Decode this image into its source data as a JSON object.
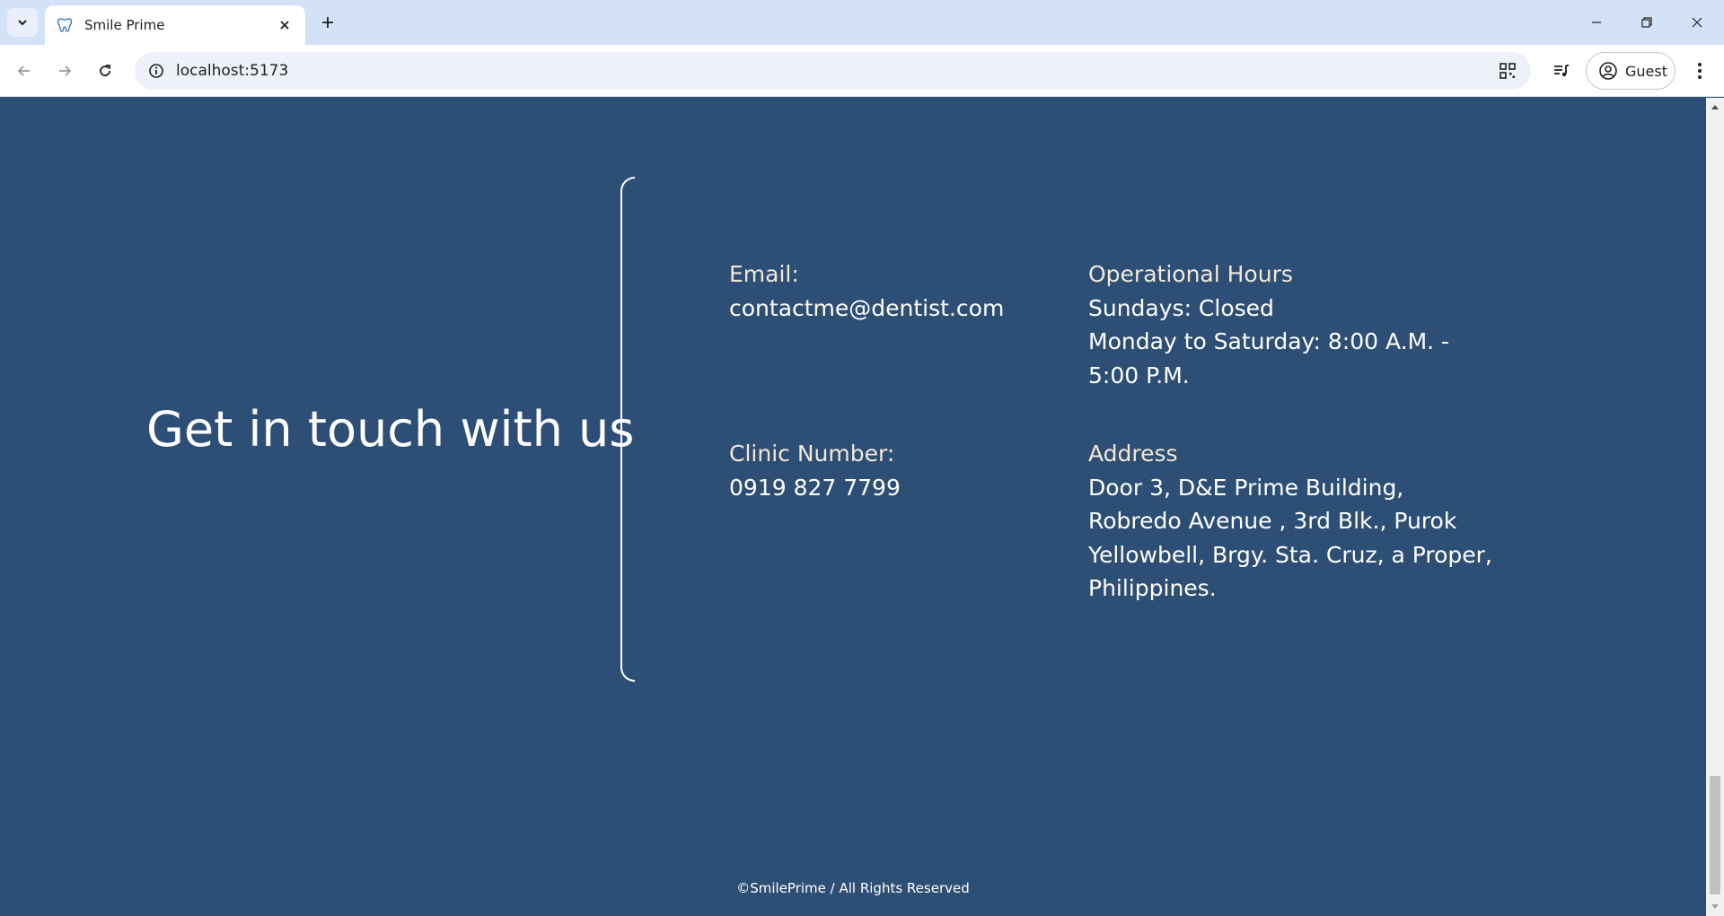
{
  "browser": {
    "tab_title": "Smile Prime",
    "url": "localhost:5173",
    "profile_label": "Guest"
  },
  "contact": {
    "heading": "Get in touch with us",
    "email_label": "Email:",
    "email_value": "contactme@dentist.com",
    "hours_label": "Operational Hours",
    "hours_line1": "Sundays: Closed",
    "hours_line2": "Monday to Saturday: 8:00 A.M. -",
    "hours_line3": "5:00 P.M.",
    "phone_label": "Clinic Number:",
    "phone_value": "0919 827 7799",
    "address_label": "Address",
    "address_line1": "Door 3, D&E Prime Building,",
    "address_line2": "Robredo Avenue , 3rd Blk., Purok",
    "address_line3": "Yellowbell, Brgy. Sta. Cruz, a Proper,",
    "address_line4": "Philippines."
  },
  "footer": {
    "copyright": "©SmilePrime / All Rights Reserved"
  },
  "colors": {
    "page_background": "#2e4f75",
    "tab_strip": "#d4e2f8",
    "label_text": "#f2e8d8",
    "value_text": "#ffffff"
  }
}
